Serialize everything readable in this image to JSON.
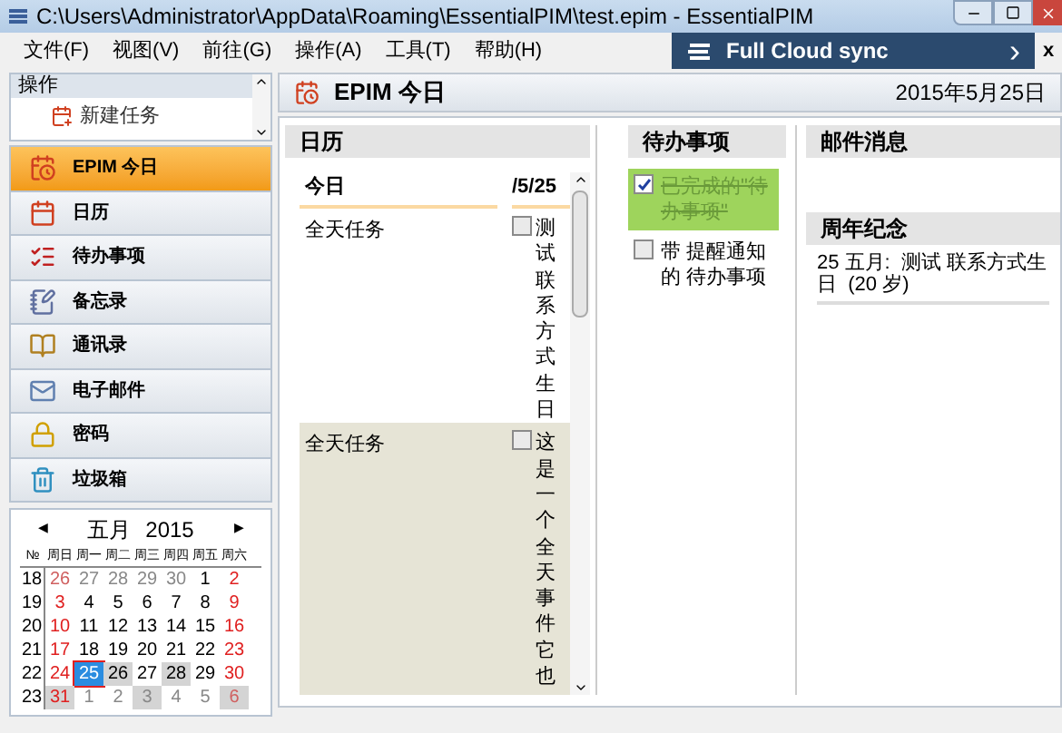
{
  "window": {
    "title": "C:\\Users\\Administrator\\AppData\\Roaming\\EssentialPIM\\test.epim - EssentialPIM"
  },
  "menu": [
    "文件(F)",
    "视图(V)",
    "前往(G)",
    "操作(A)",
    "工具(T)",
    "帮助(H)"
  ],
  "promo": {
    "label": "Full Cloud sync",
    "arrow": "›",
    "close": "x"
  },
  "actions": {
    "title": "操作",
    "items": [
      {
        "label": "新建任务"
      }
    ]
  },
  "nav": [
    {
      "label": "EPIM 今日",
      "kind": "today",
      "selected": true
    },
    {
      "label": "日历",
      "kind": "calendar",
      "selected": false
    },
    {
      "label": "待办事项",
      "kind": "todo",
      "selected": false
    },
    {
      "label": "备忘录",
      "kind": "notes",
      "selected": false
    },
    {
      "label": "通讯录",
      "kind": "contacts",
      "selected": false
    },
    {
      "label": "电子邮件",
      "kind": "mail",
      "selected": false
    },
    {
      "label": "密码",
      "kind": "password",
      "selected": false
    },
    {
      "label": "垃圾箱",
      "kind": "trash",
      "selected": false
    }
  ],
  "mini_calendar": {
    "prev": "◀",
    "next": "▶",
    "month": "五月",
    "year": "2015",
    "week_header": "№",
    "weekdays": [
      "周日",
      "周一",
      "周二",
      "周三",
      "周四",
      "周五",
      "周六"
    ],
    "weeks": [
      {
        "no": "18",
        "days": [
          {
            "d": "26",
            "muted": true,
            "marked": false,
            "selected": false
          },
          {
            "d": "27",
            "muted": true,
            "marked": false,
            "selected": false
          },
          {
            "d": "28",
            "muted": true,
            "marked": false,
            "selected": false
          },
          {
            "d": "29",
            "muted": true,
            "marked": false,
            "selected": false
          },
          {
            "d": "30",
            "muted": true,
            "marked": false,
            "selected": false
          },
          {
            "d": "1",
            "muted": false,
            "marked": false,
            "selected": false
          },
          {
            "d": "2",
            "muted": false,
            "marked": false,
            "selected": false
          }
        ]
      },
      {
        "no": "19",
        "days": [
          {
            "d": "3",
            "muted": false,
            "marked": false,
            "selected": false
          },
          {
            "d": "4",
            "muted": false,
            "marked": false,
            "selected": false
          },
          {
            "d": "5",
            "muted": false,
            "marked": false,
            "selected": false
          },
          {
            "d": "6",
            "muted": false,
            "marked": false,
            "selected": false
          },
          {
            "d": "7",
            "muted": false,
            "marked": false,
            "selected": false
          },
          {
            "d": "8",
            "muted": false,
            "marked": false,
            "selected": false
          },
          {
            "d": "9",
            "muted": false,
            "marked": false,
            "selected": false
          }
        ]
      },
      {
        "no": "20",
        "days": [
          {
            "d": "10",
            "muted": false,
            "marked": false,
            "selected": false
          },
          {
            "d": "11",
            "muted": false,
            "marked": false,
            "selected": false
          },
          {
            "d": "12",
            "muted": false,
            "marked": false,
            "selected": false
          },
          {
            "d": "13",
            "muted": false,
            "marked": false,
            "selected": false
          },
          {
            "d": "14",
            "muted": false,
            "marked": false,
            "selected": false
          },
          {
            "d": "15",
            "muted": false,
            "marked": false,
            "selected": false
          },
          {
            "d": "16",
            "muted": false,
            "marked": false,
            "selected": false
          }
        ]
      },
      {
        "no": "21",
        "days": [
          {
            "d": "17",
            "muted": false,
            "marked": false,
            "selected": false
          },
          {
            "d": "18",
            "muted": false,
            "marked": false,
            "selected": false
          },
          {
            "d": "19",
            "muted": false,
            "marked": false,
            "selected": false
          },
          {
            "d": "20",
            "muted": false,
            "marked": false,
            "selected": false
          },
          {
            "d": "21",
            "muted": false,
            "marked": false,
            "selected": false
          },
          {
            "d": "22",
            "muted": false,
            "marked": false,
            "selected": false
          },
          {
            "d": "23",
            "muted": false,
            "marked": false,
            "selected": false
          }
        ]
      },
      {
        "no": "22",
        "days": [
          {
            "d": "24",
            "muted": false,
            "marked": false,
            "selected": false
          },
          {
            "d": "25",
            "muted": false,
            "marked": false,
            "selected": true
          },
          {
            "d": "26",
            "muted": false,
            "marked": true,
            "selected": false
          },
          {
            "d": "27",
            "muted": false,
            "marked": false,
            "selected": false
          },
          {
            "d": "28",
            "muted": false,
            "marked": true,
            "selected": false
          },
          {
            "d": "29",
            "muted": false,
            "marked": false,
            "selected": false
          },
          {
            "d": "30",
            "muted": false,
            "marked": false,
            "selected": false
          }
        ]
      },
      {
        "no": "23",
        "days": [
          {
            "d": "31",
            "muted": false,
            "marked": true,
            "selected": false
          },
          {
            "d": "1",
            "muted": true,
            "marked": false,
            "selected": false
          },
          {
            "d": "2",
            "muted": true,
            "marked": false,
            "selected": false
          },
          {
            "d": "3",
            "muted": true,
            "marked": true,
            "selected": false
          },
          {
            "d": "4",
            "muted": true,
            "marked": false,
            "selected": false
          },
          {
            "d": "5",
            "muted": true,
            "marked": false,
            "selected": false
          },
          {
            "d": "6",
            "muted": true,
            "marked": true,
            "selected": false
          }
        ]
      }
    ]
  },
  "header": {
    "title": "EPIM 今日",
    "date": "2015年5月25日"
  },
  "calendar_panel": {
    "title": "日历",
    "column_1": "今日",
    "column_2": "/5/25",
    "events": [
      {
        "time": "全天任务",
        "text": "测试联系方式生日",
        "checked": false,
        "highlighted": false
      },
      {
        "time": "全天任务",
        "text": "这是一个全天事件它也",
        "checked": false,
        "highlighted": true
      }
    ]
  },
  "todo_panel": {
    "title": "待办事项",
    "items": [
      {
        "text": "已完成的\"待办事项\"",
        "checked": true
      },
      {
        "text": "带 提醒通知的 待办事项",
        "checked": false
      }
    ]
  },
  "mail_panel": {
    "title": "邮件消息"
  },
  "anniversary_panel": {
    "title": "周年纪念",
    "items": [
      "25 五月:  测试 联系方式生日  (20 岁)"
    ]
  }
}
